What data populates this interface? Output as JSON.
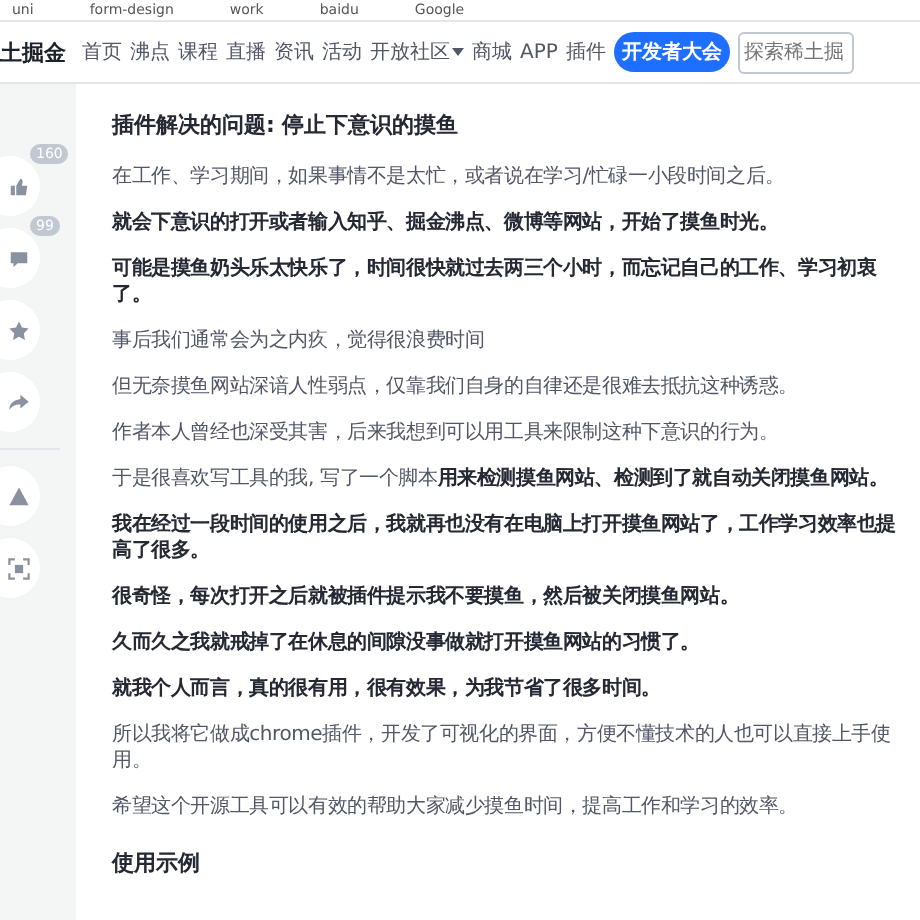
{
  "bookmarks": [
    "uni",
    "form-design",
    "work",
    "baidu",
    "Google"
  ],
  "nav": {
    "logo": "土掘金",
    "items": [
      {
        "label": "首页",
        "dropdown": false
      },
      {
        "label": "沸点",
        "dropdown": false
      },
      {
        "label": "课程",
        "dropdown": false
      },
      {
        "label": "直播",
        "dropdown": false
      },
      {
        "label": "资讯",
        "dropdown": false
      },
      {
        "label": "活动",
        "dropdown": false
      },
      {
        "label": "开放社区",
        "dropdown": true
      },
      {
        "label": "商城",
        "dropdown": false
      },
      {
        "label": "APP",
        "dropdown": false
      },
      {
        "label": "插件",
        "dropdown": false
      }
    ],
    "promo": "开发者大会",
    "search": {
      "placeholder": "探索稀土掘"
    }
  },
  "side_actions": [
    {
      "kind": "like",
      "count": "160"
    },
    {
      "kind": "comment",
      "count": "99"
    },
    {
      "kind": "star"
    },
    {
      "kind": "share"
    },
    {
      "kind": "divider"
    },
    {
      "kind": "report"
    },
    {
      "kind": "focus"
    }
  ],
  "article": [
    {
      "kind": "heading",
      "text": "插件解决的问题: 停止下意识的摸鱼"
    },
    {
      "kind": "para",
      "bold": false,
      "text": "在工作、学习期间，如果事情不是太忙，或者说在学习/忙碌一小段时间之后。"
    },
    {
      "kind": "para",
      "bold": true,
      "text": "就会下意识的打开或者输入知乎、掘金沸点、微博等网站，开始了摸鱼时光。"
    },
    {
      "kind": "para",
      "bold": true,
      "text": "可能是摸鱼奶头乐太快乐了，时间很快就过去两三个小时，而忘记自己的工作、学习初衷了。"
    },
    {
      "kind": "para",
      "bold": false,
      "text": "事后我们通常会为之内疚，觉得很浪费时间"
    },
    {
      "kind": "para",
      "bold": false,
      "text": "但无奈摸鱼网站深谙人性弱点，仅靠我们自身的自律还是很难去抵抗这种诱惑。"
    },
    {
      "kind": "para",
      "bold": false,
      "text": "作者本人曾经也深受其害，后来我想到可以用工具来限制这种下意识的行为。"
    },
    {
      "kind": "para",
      "bold": false,
      "text": "于是很喜欢写工具的我, 写了一个脚本**用来检测摸鱼网站、检测到了就自动关闭摸鱼网站。**"
    },
    {
      "kind": "para",
      "bold": true,
      "text": "我在经过一段时间的使用之后，我就再也没有在电脑上打开摸鱼网站了，工作学习效率也提高了很多。"
    },
    {
      "kind": "para",
      "bold": true,
      "text": "很奇怪，每次打开之后就被插件提示我不要摸鱼，然后被关闭摸鱼网站。"
    },
    {
      "kind": "para",
      "bold": true,
      "text": "久而久之我就戒掉了在休息的间隙没事做就打开摸鱼网站的习惯了。"
    },
    {
      "kind": "para",
      "bold": true,
      "text": "就我个人而言，真的很有用，很有效果，为我节省了很多时间。"
    },
    {
      "kind": "para",
      "bold": false,
      "text": "所以我将它做成chrome插件，开发了可视化的界面，方便不懂技术的人也可以直接上手使用。"
    },
    {
      "kind": "para",
      "bold": false,
      "text": "希望这个开源工具可以有效的帮助大家减少摸鱼时间，提高工作和学习的效率。"
    },
    {
      "kind": "heading",
      "text": "使用示例"
    }
  ]
}
